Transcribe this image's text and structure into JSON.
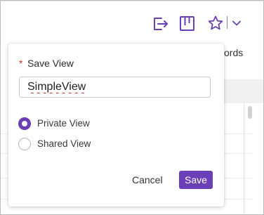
{
  "toolbar": {
    "icons": [
      "export-icon",
      "board-icon",
      "star-icon",
      "chevron-down-icon"
    ],
    "accent_color": "#6a3fb8"
  },
  "background": {
    "records_text": "ords"
  },
  "save_view_dialog": {
    "required_marker": "*",
    "title": "Save View",
    "name_value": "SimpleView",
    "options": [
      {
        "label": "Private View",
        "selected": true
      },
      {
        "label": "Shared View",
        "selected": false
      }
    ],
    "cancel_label": "Cancel",
    "save_label": "Save"
  },
  "colors": {
    "primary": "#6a3fb8",
    "required": "#d0322f"
  }
}
